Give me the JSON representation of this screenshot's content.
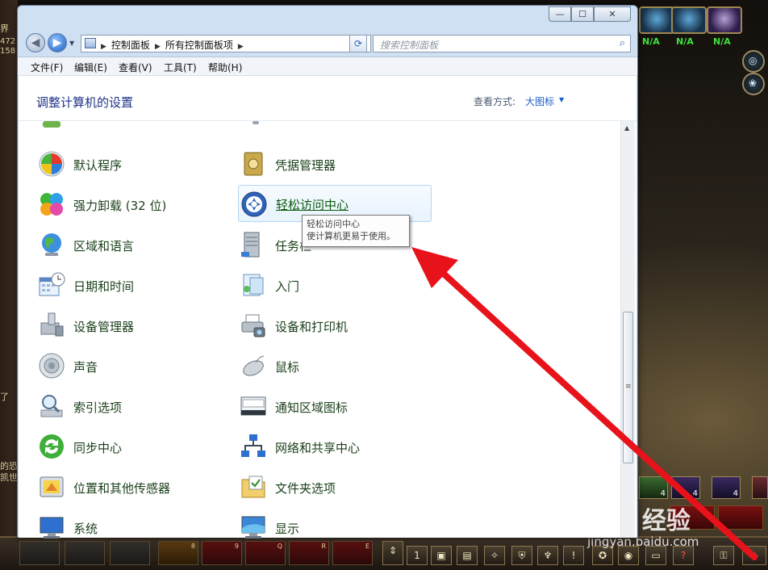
{
  "window": {
    "caption_min": "—",
    "caption_max": "☐",
    "caption_close": "✕"
  },
  "address": {
    "crumbs": [
      "控制面板",
      "所有控制面板项"
    ],
    "search_placeholder": "搜索控制面板"
  },
  "menu": [
    "文件(F)",
    "编辑(E)",
    "查看(V)",
    "工具(T)",
    "帮助(H)"
  ],
  "header": {
    "title": "调整计算机的设置",
    "view_label": "查看方式:",
    "view_value": "大图标"
  },
  "items_left": [
    {
      "label": "默认程序",
      "icon": "default-programs-icon"
    },
    {
      "label": "强力卸载 (32 位)",
      "icon": "uninstall-icon"
    },
    {
      "label": "区域和语言",
      "icon": "globe-icon"
    },
    {
      "label": "日期和时间",
      "icon": "calendar-clock-icon"
    },
    {
      "label": "设备管理器",
      "icon": "device-manager-icon"
    },
    {
      "label": "声音",
      "icon": "speaker-icon"
    },
    {
      "label": "索引选项",
      "icon": "index-icon"
    },
    {
      "label": "同步中心",
      "icon": "sync-icon"
    },
    {
      "label": "位置和其他传感器",
      "icon": "sensor-icon"
    },
    {
      "label": "系统",
      "icon": "system-icon"
    }
  ],
  "items_right": [
    {
      "label": "凭据管理器",
      "icon": "credential-icon"
    },
    {
      "label": "轻松访问中心",
      "icon": "ease-of-access-icon"
    },
    {
      "label": "任务栏",
      "icon": "taskbar-icon"
    },
    {
      "label": "入门",
      "icon": "getting-started-icon"
    },
    {
      "label": "设备和打印机",
      "icon": "printer-icon"
    },
    {
      "label": "鼠标",
      "icon": "mouse-icon"
    },
    {
      "label": "通知区域图标",
      "icon": "notification-icon"
    },
    {
      "label": "网络和共享中心",
      "icon": "network-icon"
    },
    {
      "label": "文件夹选项",
      "icon": "folder-options-icon"
    },
    {
      "label": "显示",
      "icon": "display-icon"
    }
  ],
  "tooltip": {
    "title": "轻松访问中心",
    "desc": "使计算机更易于使用。"
  },
  "game": {
    "left_frag_1": "界",
    "left_frag_2": "472",
    "left_frag_3": "158",
    "left_frag_4": "的恐",
    "left_frag_5": "凯世",
    "left_frag_6": "了",
    "hud_na": [
      "N/A",
      "N/A",
      "N/A"
    ],
    "unit_counts": [
      "4",
      "4",
      "4"
    ],
    "slot_keys": [
      "8",
      "9",
      "Q",
      "R",
      "E",
      "1"
    ],
    "watermark": "Bai 经验",
    "watermark_url": "jingyan.baidu.com"
  },
  "colors": {
    "arrow": "#e8121a",
    "link": "#1a5fc8",
    "title": "#1e3287"
  }
}
